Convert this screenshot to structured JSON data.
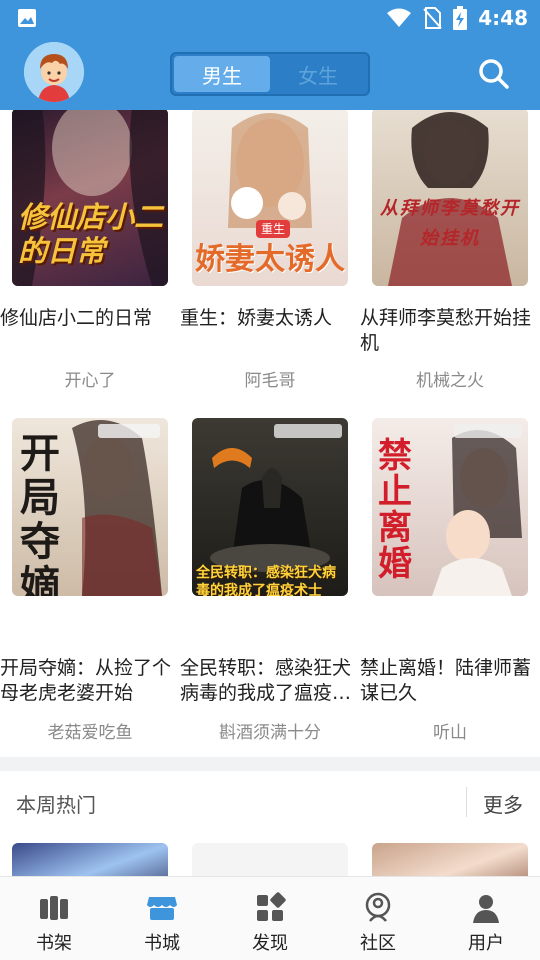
{
  "status_bar": {
    "time": "4:48"
  },
  "header": {
    "tabs": [
      {
        "label": "男生",
        "active": true
      },
      {
        "label": "女生",
        "active": false
      }
    ]
  },
  "books_row1": [
    {
      "title": "修仙店小二的日常",
      "author": "开心了",
      "cover_text": "修仙店小二的日常"
    },
    {
      "title": "重生：娇妻太诱人",
      "author": "阿毛哥",
      "cover_text": "娇妻太诱人"
    },
    {
      "title": "从拜师李莫愁开始挂机",
      "author": "机械之火",
      "cover_text": "从拜师李莫愁开始挂机"
    }
  ],
  "books_row2": [
    {
      "title": "开局夺嫡：从捡了个母老虎老婆开始",
      "author": "老菇爱吃鱼",
      "cover_text": "开局夺嫡"
    },
    {
      "title": "全民转职：感染狂犬病毒的我成了瘟疫…",
      "author": "斟酒须满十分",
      "cover_text": "全民转职：感染狂犬病毒的我成了瘟疫术士"
    },
    {
      "title": "禁止离婚！陆律师蓄谋已久",
      "author": "听山",
      "cover_text": "禁止离婚"
    }
  ],
  "section": {
    "title": "本周热门",
    "more": "更多"
  },
  "bottom_nav": [
    {
      "label": "书架",
      "icon": "bookshelf-icon",
      "active": false
    },
    {
      "label": "书城",
      "icon": "store-icon",
      "active": true
    },
    {
      "label": "发现",
      "icon": "discover-icon",
      "active": false
    },
    {
      "label": "社区",
      "icon": "community-icon",
      "active": false
    },
    {
      "label": "用户",
      "icon": "user-icon",
      "active": false
    }
  ],
  "colors": {
    "primary": "#3e95dc",
    "active_tab": "#65acea",
    "nav_active": "#3e95dc"
  }
}
